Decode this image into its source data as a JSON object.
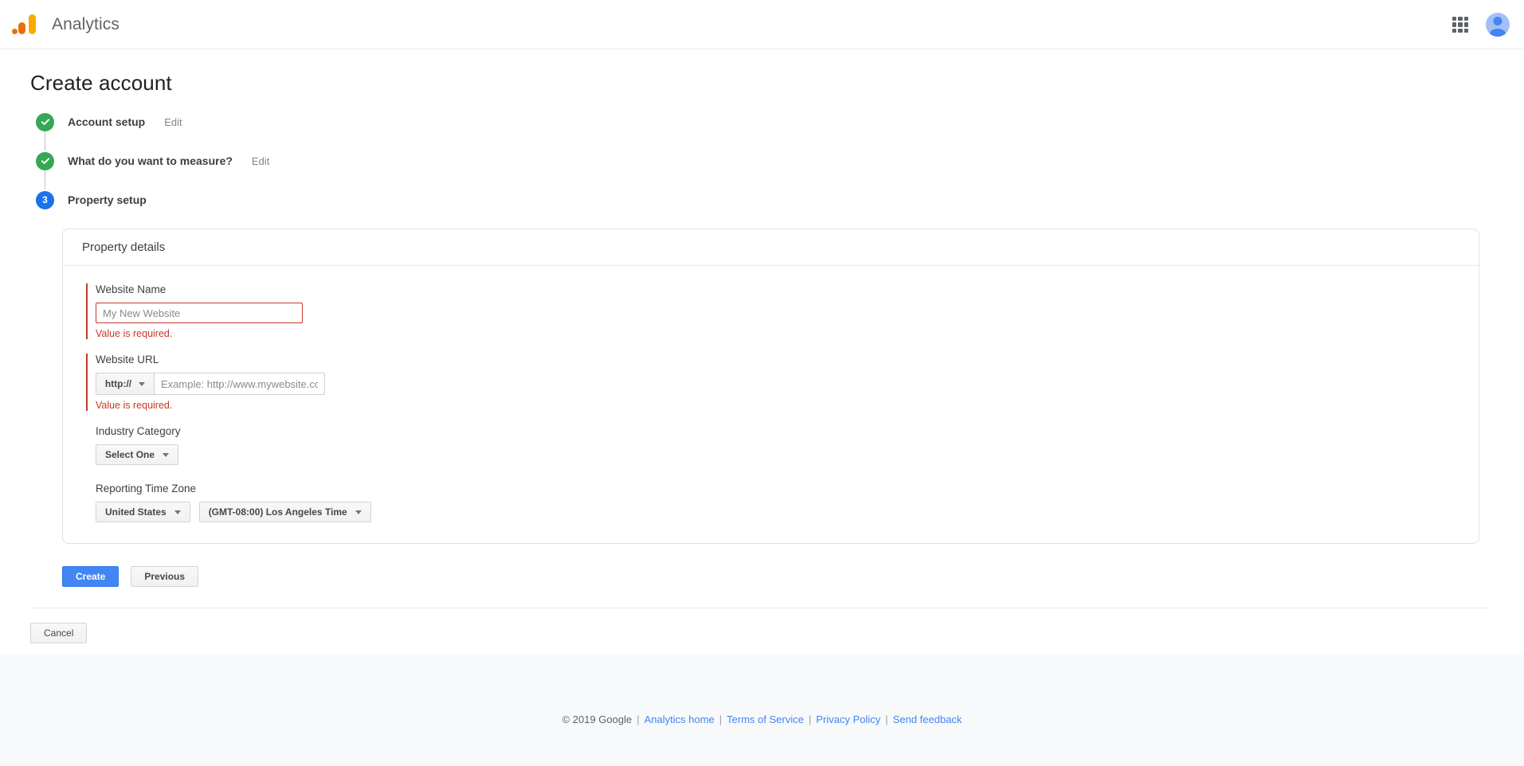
{
  "appbar": {
    "brand_name": "Analytics",
    "logo_icon": "google-analytics-logo",
    "apps_icon": "apps-grid-icon",
    "avatar_icon": "user-avatar-icon"
  },
  "page": {
    "title": "Create account"
  },
  "stepper": {
    "steps": [
      {
        "label": "Account setup",
        "state": "done",
        "marker": "check-icon",
        "edit_label": "Edit"
      },
      {
        "label": "What do you want to measure?",
        "state": "done",
        "marker": "check-icon",
        "edit_label": "Edit"
      },
      {
        "label": "Property setup",
        "state": "current",
        "marker": "3",
        "edit_label": ""
      }
    ]
  },
  "card": {
    "header": "Property details",
    "website_name": {
      "label": "Website Name",
      "value": "",
      "placeholder": "My New Website",
      "error": "Value is required."
    },
    "website_url": {
      "label": "Website URL",
      "protocol": "http://",
      "value": "",
      "placeholder": "Example: http://www.mywebsite.com",
      "error": "Value is required.",
      "caret_icon": "chevron-down-icon"
    },
    "industry_category": {
      "label": "Industry Category",
      "value": "Select One",
      "caret_icon": "chevron-down-icon"
    },
    "reporting_time_zone": {
      "label": "Reporting Time Zone",
      "country": "United States",
      "timezone": "(GMT-08:00) Los Angeles Time",
      "caret_icon": "chevron-down-icon"
    }
  },
  "actions": {
    "create_label": "Create",
    "previous_label": "Previous",
    "cancel_label": "Cancel"
  },
  "footer": {
    "copyright": "© 2019 Google",
    "sep": "|",
    "links": [
      {
        "label": "Analytics home"
      },
      {
        "label": "Terms of Service"
      },
      {
        "label": "Privacy Policy"
      },
      {
        "label": "Send feedback"
      }
    ]
  },
  "colors": {
    "brand_orange": "#e8710a",
    "brand_amber": "#f9ab00",
    "primary_blue": "#4285f4",
    "step_blue": "#1a73e8",
    "success_green": "#34a853",
    "error_red": "#c53929",
    "footer_bg": "#f8f9fa"
  }
}
